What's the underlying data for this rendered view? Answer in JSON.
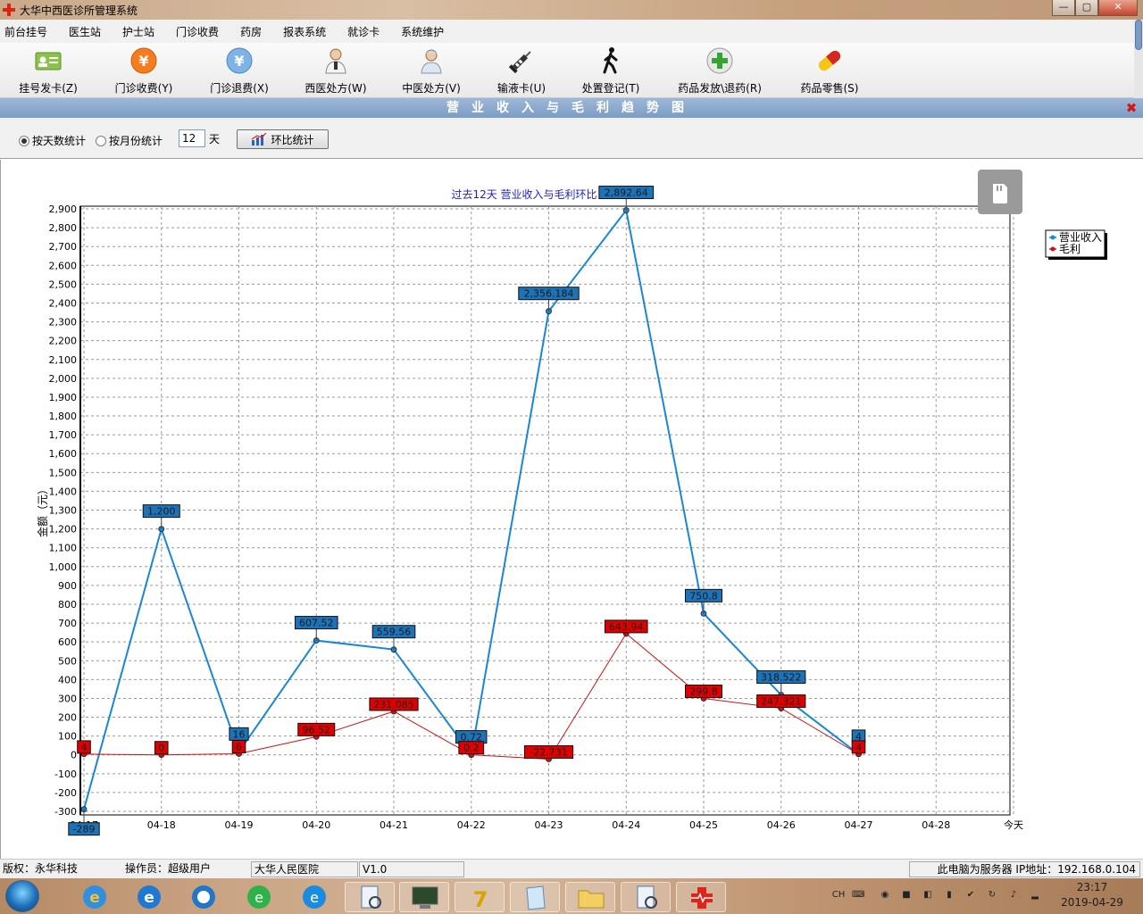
{
  "window": {
    "title": "大华中西医诊所管理系统",
    "minimize_label": "—",
    "maximize_label": "▢",
    "close_label": "✕"
  },
  "menu": [
    "前台挂号",
    "医生站",
    "护士站",
    "门诊收费",
    "药房",
    "报表系统",
    "就诊卡",
    "系统维护"
  ],
  "toolbar": [
    {
      "label": "挂号发卡(Z)",
      "icon": "id-card-icon"
    },
    {
      "label": "门诊收费(Y)",
      "icon": "yuan-coin-icon"
    },
    {
      "label": "门诊退费(X)",
      "icon": "yuan-refund-icon"
    },
    {
      "label": "西医处方(W)",
      "icon": "doctor-icon"
    },
    {
      "label": "中医处方(V)",
      "icon": "chinese-doctor-icon"
    },
    {
      "label": "输液卡(U)",
      "icon": "syringe-icon"
    },
    {
      "label": "处置登记(T)",
      "icon": "walking-person-icon"
    },
    {
      "label": "药品发放\\退药(R)",
      "icon": "medicine-plus-icon"
    },
    {
      "label": "药品零售(S)",
      "icon": "pill-capsule-icon"
    }
  ],
  "panel": {
    "title": "营业收入与毛利趋势图",
    "close_label": "✖",
    "radio_by_day": "按天数统计",
    "radio_by_month": "按月份统计",
    "days_value": "12",
    "days_unit": "天",
    "compare_button": "环比统计"
  },
  "chart_data": {
    "type": "line",
    "title": "过去12天 营业收入与毛利环比",
    "ylabel": "金额（元）",
    "xlabel": "",
    "categories": [
      "04-17",
      "04-18",
      "04-19",
      "04-20",
      "04-21",
      "04-22",
      "04-23",
      "04-24",
      "04-25",
      "04-26",
      "04-27",
      "04-28",
      "今天"
    ],
    "ylim": [
      -300,
      2900
    ],
    "ytick_step": 100,
    "grid": true,
    "legend_position": "top-right",
    "series": [
      {
        "name": "营业收入",
        "color": "#1a86d6",
        "label_color": "#1d73b8",
        "values": [
          -289,
          1200,
          16,
          607.52,
          559.56,
          0.72,
          2356.184,
          2892.64,
          750.8,
          318.522,
          4
        ],
        "labels": [
          "-289",
          "1,200",
          "16",
          "607.52",
          "559.56",
          "0.72",
          "2,356.184",
          "2,892.64",
          "750.8",
          "318.522",
          "4"
        ]
      },
      {
        "name": "毛利",
        "color": "#cc1111",
        "label_color": "#e00000",
        "values": [
          4,
          0,
          6,
          96.52,
          231.085,
          0.2,
          -22.731,
          643.94,
          299.8,
          247.321,
          4
        ],
        "labels": [
          "4",
          "0",
          "6",
          "96.52",
          "231.085",
          "0.2",
          "-22.731",
          "643.94",
          "299.8",
          "247.321",
          "4"
        ]
      }
    ]
  },
  "status": {
    "copyright": "版权：永华科技",
    "operator": "操作员：超级用户",
    "hospital": "大华人民医院",
    "version": "V1.0",
    "server": "此电脑为服务器 IP地址：192.168.0.104"
  },
  "taskbar": {
    "ime_label": "CH",
    "time": "23:17",
    "date": "2019-04-29",
    "apps": [
      "ie-icon",
      "ie-icon",
      "browser-icon",
      "green-refresh-icon",
      "ie-blue-icon",
      "magnifier-doc-icon",
      "monitor-icon",
      "seven-zip-icon",
      "notepad-icon",
      "folder-icon",
      "magnifier-doc-icon",
      "medical-app-icon"
    ]
  }
}
